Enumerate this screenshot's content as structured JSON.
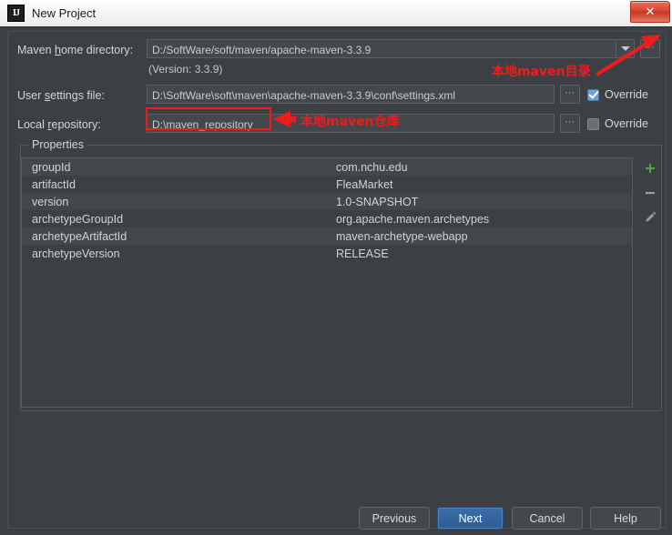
{
  "window": {
    "title": "New Project",
    "app_icon": "intellij-idea-icon",
    "close_label": "✕"
  },
  "form": {
    "maven_home": {
      "label_pre": "Maven ",
      "label_mnemonic": "h",
      "label_post": "ome directory:",
      "value": "D:/SoftWare/soft/maven/apache-maven-3.3.9",
      "dropdown_icon": "chevron-down-icon",
      "browse_label": "⋯"
    },
    "version_note": "(Version: 3.3.9)",
    "user_settings": {
      "label_pre": "User ",
      "label_mnemonic": "s",
      "label_post": "ettings file:",
      "value": "D:\\SoftWare\\soft\\maven\\apache-maven-3.3.9\\conf\\settings.xml",
      "browse_label": "⋯",
      "override_label": "Override",
      "override_checked": true
    },
    "local_repository": {
      "label_pre": "Local ",
      "label_mnemonic": "r",
      "label_post": "epository:",
      "value": "D:\\maven_repository",
      "browse_label": "⋯",
      "override_label": "Override",
      "override_checked": false
    }
  },
  "properties": {
    "legend": "Properties",
    "rows": [
      {
        "key": "groupId",
        "value": "com.nchu.edu"
      },
      {
        "key": "artifactId",
        "value": "FleaMarket"
      },
      {
        "key": "version",
        "value": "1.0-SNAPSHOT"
      },
      {
        "key": "archetypeGroupId",
        "value": "org.apache.maven.archetypes"
      },
      {
        "key": "archetypeArtifactId",
        "value": "maven-archetype-webapp"
      },
      {
        "key": "archetypeVersion",
        "value": "RELEASE"
      }
    ],
    "tools": [
      {
        "name": "add-property-icon",
        "glyph": "+",
        "color": "#51a34f"
      },
      {
        "name": "remove-property-icon",
        "glyph": "−",
        "color": "#9a9d9f"
      },
      {
        "name": "edit-property-icon",
        "glyph": "✎",
        "color": "#9a9d9f"
      }
    ]
  },
  "footer": {
    "previous": "Previous",
    "next": "Next",
    "cancel": "Cancel",
    "help": "Help"
  },
  "annotations": {
    "maven_home_note": "本地maven目录",
    "local_repo_note": "本地maven仓库",
    "color": "#f01c1c"
  }
}
